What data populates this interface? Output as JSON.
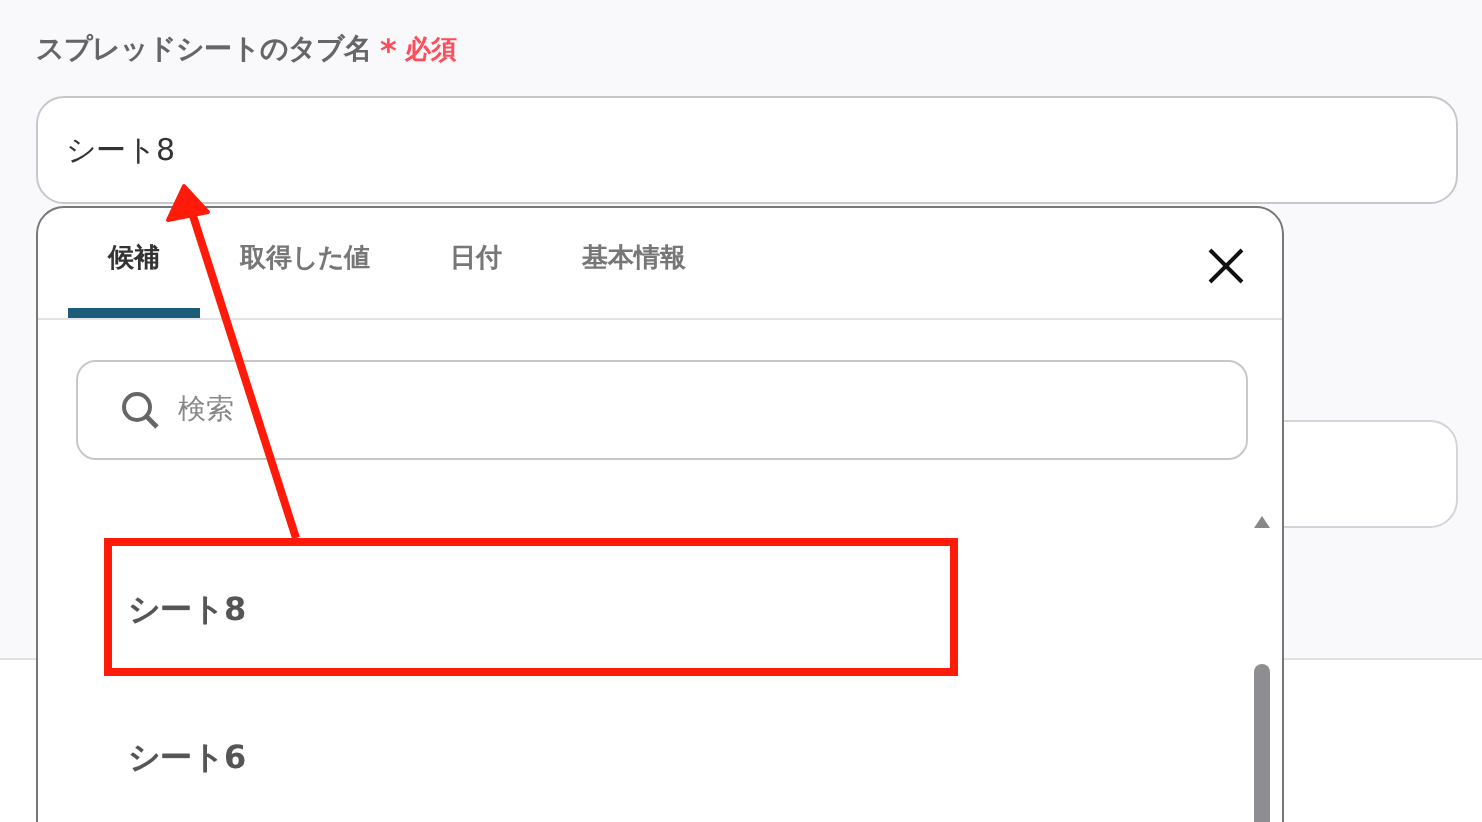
{
  "field": {
    "label": "スプレッドシートのタブ名",
    "required_mark": "*",
    "required_text": "必須",
    "value": "シート8"
  },
  "picker": {
    "tabs": [
      {
        "label": "候補",
        "selected": true
      },
      {
        "label": "取得した値",
        "selected": false
      },
      {
        "label": "日付",
        "selected": false
      },
      {
        "label": "基本情報",
        "selected": false
      }
    ],
    "search": {
      "placeholder": "検索"
    },
    "options": [
      {
        "label": "シート8",
        "highlighted": true
      },
      {
        "label": "シート6",
        "highlighted": false
      }
    ]
  }
}
